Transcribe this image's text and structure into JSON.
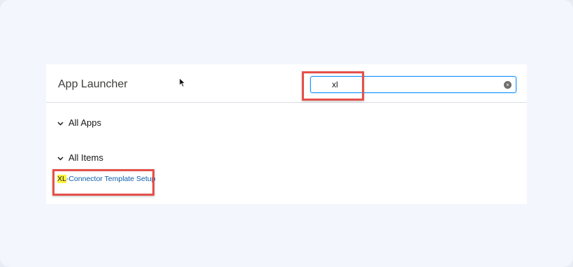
{
  "app_launcher": {
    "title": "App Launcher",
    "search": {
      "value": "xl",
      "clear_label": "×"
    },
    "sections": {
      "all_apps": "All Apps",
      "all_items": "All Items"
    },
    "results": [
      {
        "match": "XL",
        "rest": "-Connector Template Setup"
      }
    ],
    "chevron": "⌄"
  },
  "colors": {
    "highlight_box": "#e5504a",
    "link": "#0b5cab",
    "match_bg": "#fbf43b",
    "focus_border": "#1b96ff"
  }
}
